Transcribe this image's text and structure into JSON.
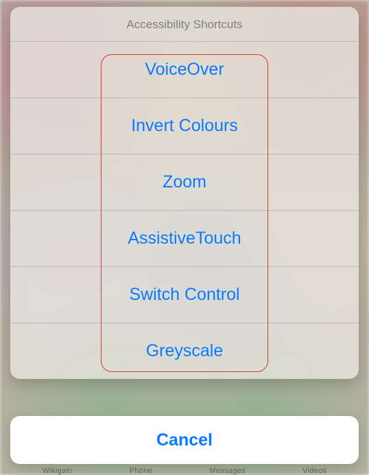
{
  "sheet": {
    "title": "Accessibility Shortcuts",
    "options": [
      {
        "label": "VoiceOver"
      },
      {
        "label": "Invert Colours"
      },
      {
        "label": "Zoom"
      },
      {
        "label": "AssistiveTouch"
      },
      {
        "label": "Switch Control"
      },
      {
        "label": "Greyscale"
      }
    ],
    "cancel": "Cancel"
  },
  "colors": {
    "accent": "#0a7aff",
    "highlight_border": "#d43a2a"
  },
  "dock": {
    "labels": [
      "Wikigain",
      "Phone",
      "Messages",
      "Videos"
    ]
  }
}
